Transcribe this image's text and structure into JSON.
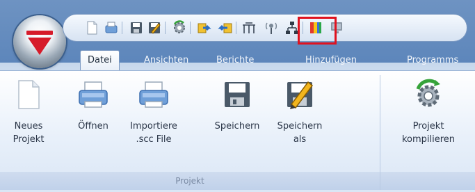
{
  "tabs": [
    "Datei",
    "Ansichten",
    "Berichte",
    "Hinzufügen",
    "Programms"
  ],
  "groups": {
    "projekt": {
      "label": "Projekt",
      "buttons": [
        {
          "line1": "Neues",
          "line2": "Projekt"
        },
        {
          "line1": "Öffnen",
          "line2": ""
        },
        {
          "line1": "Importiere",
          "line2": ".scc File"
        },
        {
          "line1": "Speichern",
          "line2": ""
        },
        {
          "line1": "Speichern",
          "line2": "als"
        }
      ]
    },
    "compile": {
      "buttons": [
        {
          "line1": "Projekt",
          "line2": "kompilieren"
        }
      ]
    }
  },
  "quick_access_icons": [
    "new-document-icon",
    "open-icon",
    "save-icon",
    "save-as-icon",
    "compile-icon",
    "export-icon",
    "import-icon",
    "bus-config-icon",
    "antenna-icon",
    "network-icon",
    "color-palette-icon",
    "monitor-icon"
  ],
  "colors": {
    "title_bar": "#5d86bb",
    "highlight_box": "#e0121f",
    "orb_triangle": "#d61b2a"
  }
}
